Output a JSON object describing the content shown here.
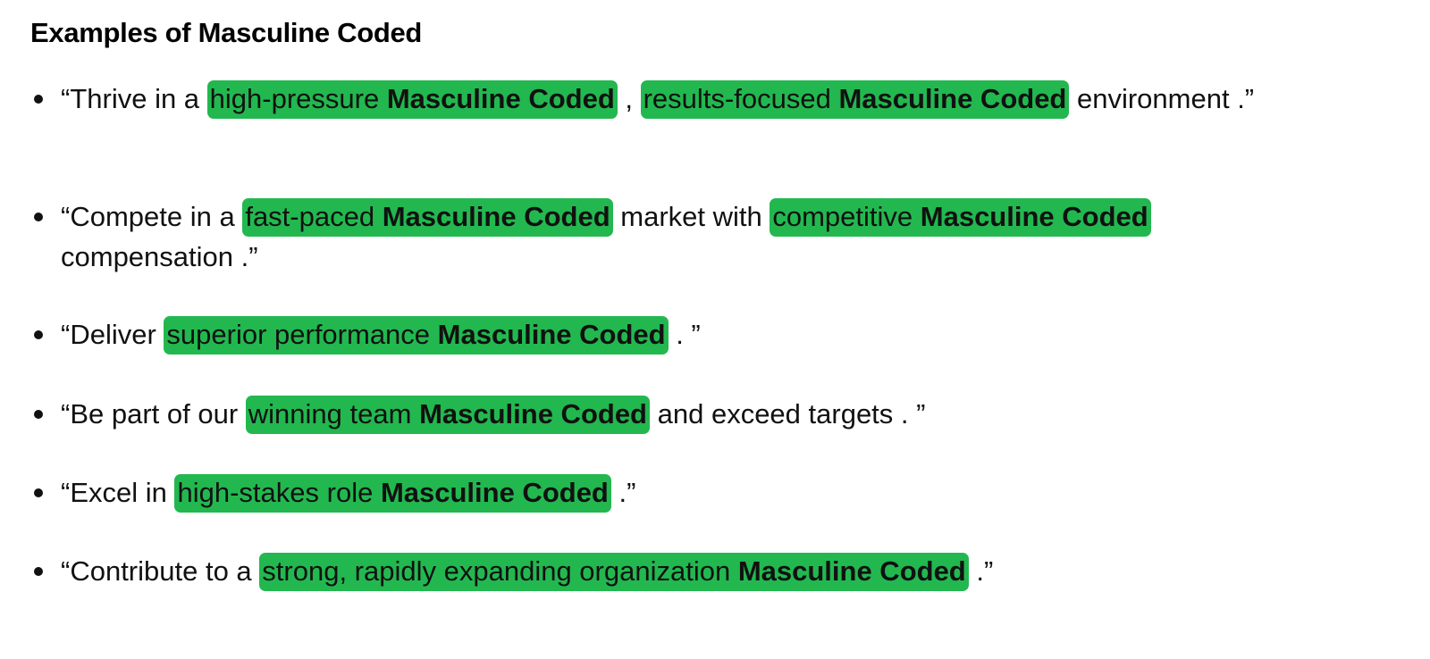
{
  "heading": "Examples of Masculine Coded",
  "tag_label": "Masculine Coded",
  "examples": [
    {
      "before": "“Thrive in a ",
      "hl1": "high-pressure ",
      "mid": " , ",
      "hl2": "results-focused ",
      "after": " environment .”"
    },
    {
      "before": "“Compete in a ",
      "hl1": "fast-paced ",
      "mid": " market with ",
      "hl2": "competitive ",
      "after": " compensation .”"
    },
    {
      "before": "“Deliver ",
      "hl1": "superior performance ",
      "after": " . ”"
    },
    {
      "before": "“Be part of our ",
      "hl1": "winning team ",
      "after": " and exceed targets . ”"
    },
    {
      "before": "“Excel in ",
      "hl1": "high-stakes role ",
      "after": " .”"
    },
    {
      "before": "“Contribute to a ",
      "hl1": "strong, rapidly expanding organization ",
      "after": " .”"
    }
  ],
  "colors": {
    "highlight": "#22b84f",
    "text": "#111111"
  }
}
